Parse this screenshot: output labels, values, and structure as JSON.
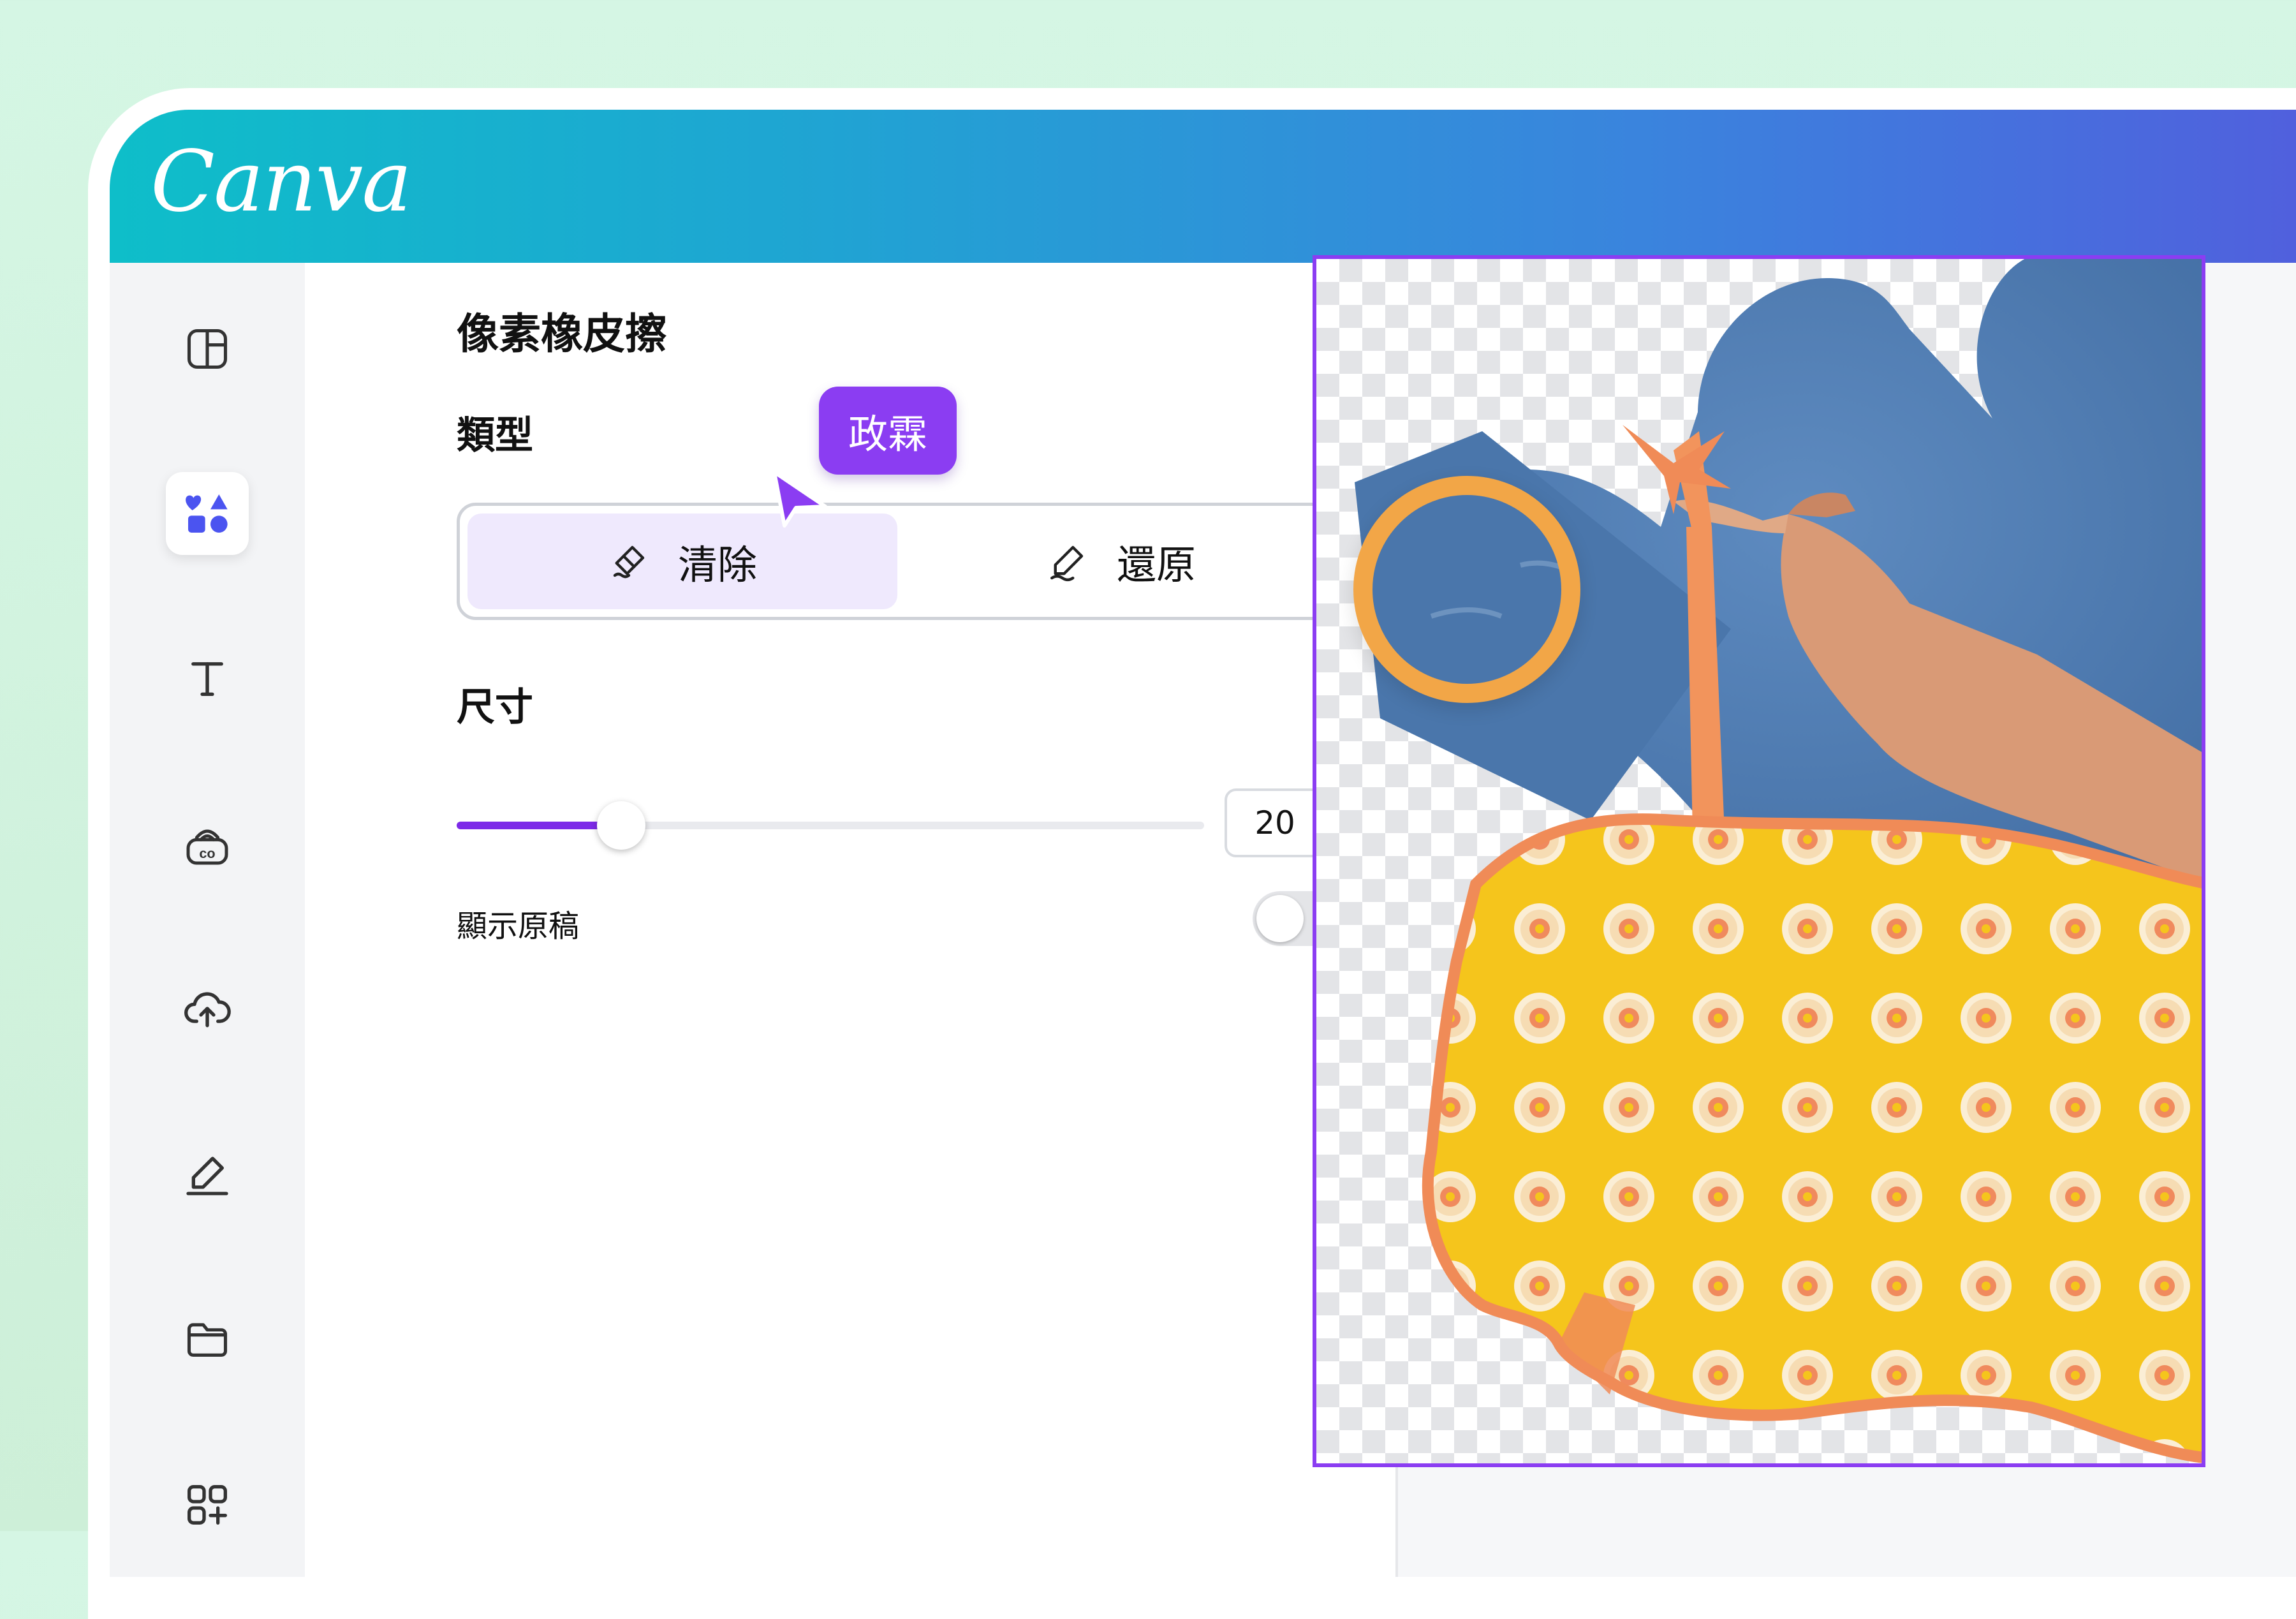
{
  "app": {
    "logo": "Canva"
  },
  "colors": {
    "accent": "#7d2ae8",
    "tooltip": "#8b3df2",
    "eraser_ring": "#f2a647",
    "sky": "#4a76ab"
  },
  "sidebar": {
    "icons": [
      "layout-icon",
      "elements-icon",
      "text-icon",
      "brand-icon",
      "upload-icon",
      "draw-icon",
      "folder-icon",
      "apps-icon"
    ],
    "active": "elements-icon"
  },
  "panel": {
    "title": "像素橡皮擦",
    "type_label": "類型",
    "erase_label": "清除",
    "restore_label": "還原",
    "size_label": "尺寸",
    "size_value": "20",
    "size_fraction": 0.22,
    "show_original_label": "顯示原稿",
    "show_original_on": false
  },
  "collaborator": {
    "name": "政霖"
  }
}
